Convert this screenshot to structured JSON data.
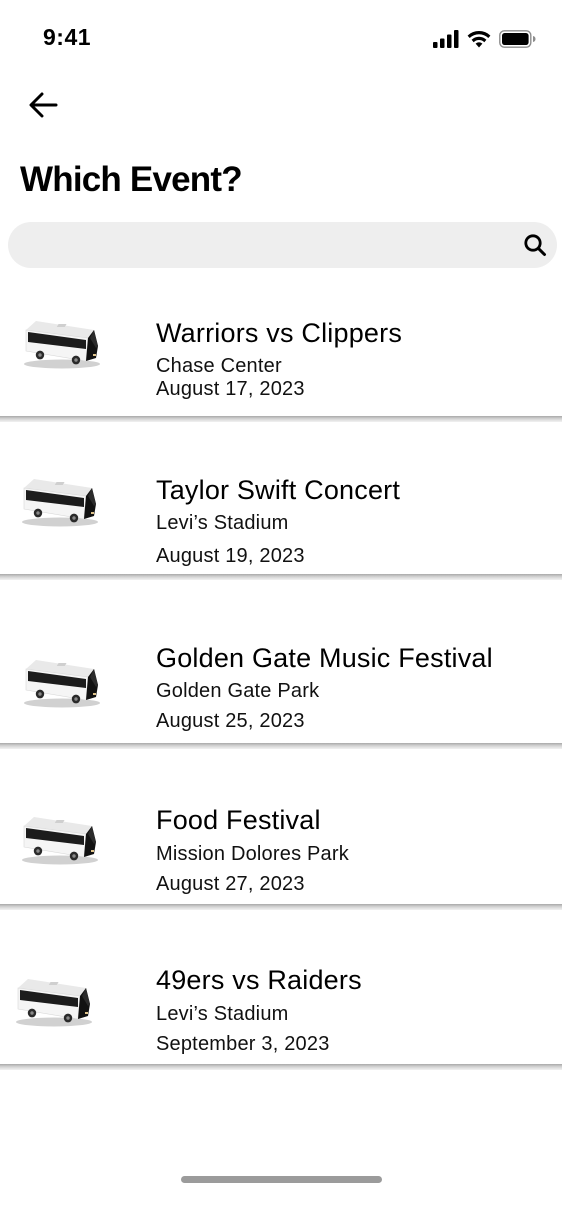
{
  "status_bar": {
    "time": "9:41"
  },
  "header": {
    "title": "Which Event?"
  },
  "search": {
    "placeholder": "",
    "value": ""
  },
  "events": [
    {
      "name": "Warriors vs Clippers",
      "venue": "Chase Center",
      "date": "August 17, 2023"
    },
    {
      "name": "Taylor Swift Concert",
      "venue": "Levi’s Stadium",
      "date": "August 19, 2023"
    },
    {
      "name": "Golden Gate Music Festival",
      "venue": "Golden Gate Park",
      "date": "August 25, 2023"
    },
    {
      "name": "Food Festival",
      "venue": "Mission Dolores Park",
      "date": "August 27, 2023"
    },
    {
      "name": "49ers vs Raiders",
      "venue": "Levi’s Stadium",
      "date": "September 3, 2023"
    }
  ],
  "icons": {
    "back": "arrow-left-icon",
    "search": "search-icon",
    "event": "bus-icon"
  }
}
